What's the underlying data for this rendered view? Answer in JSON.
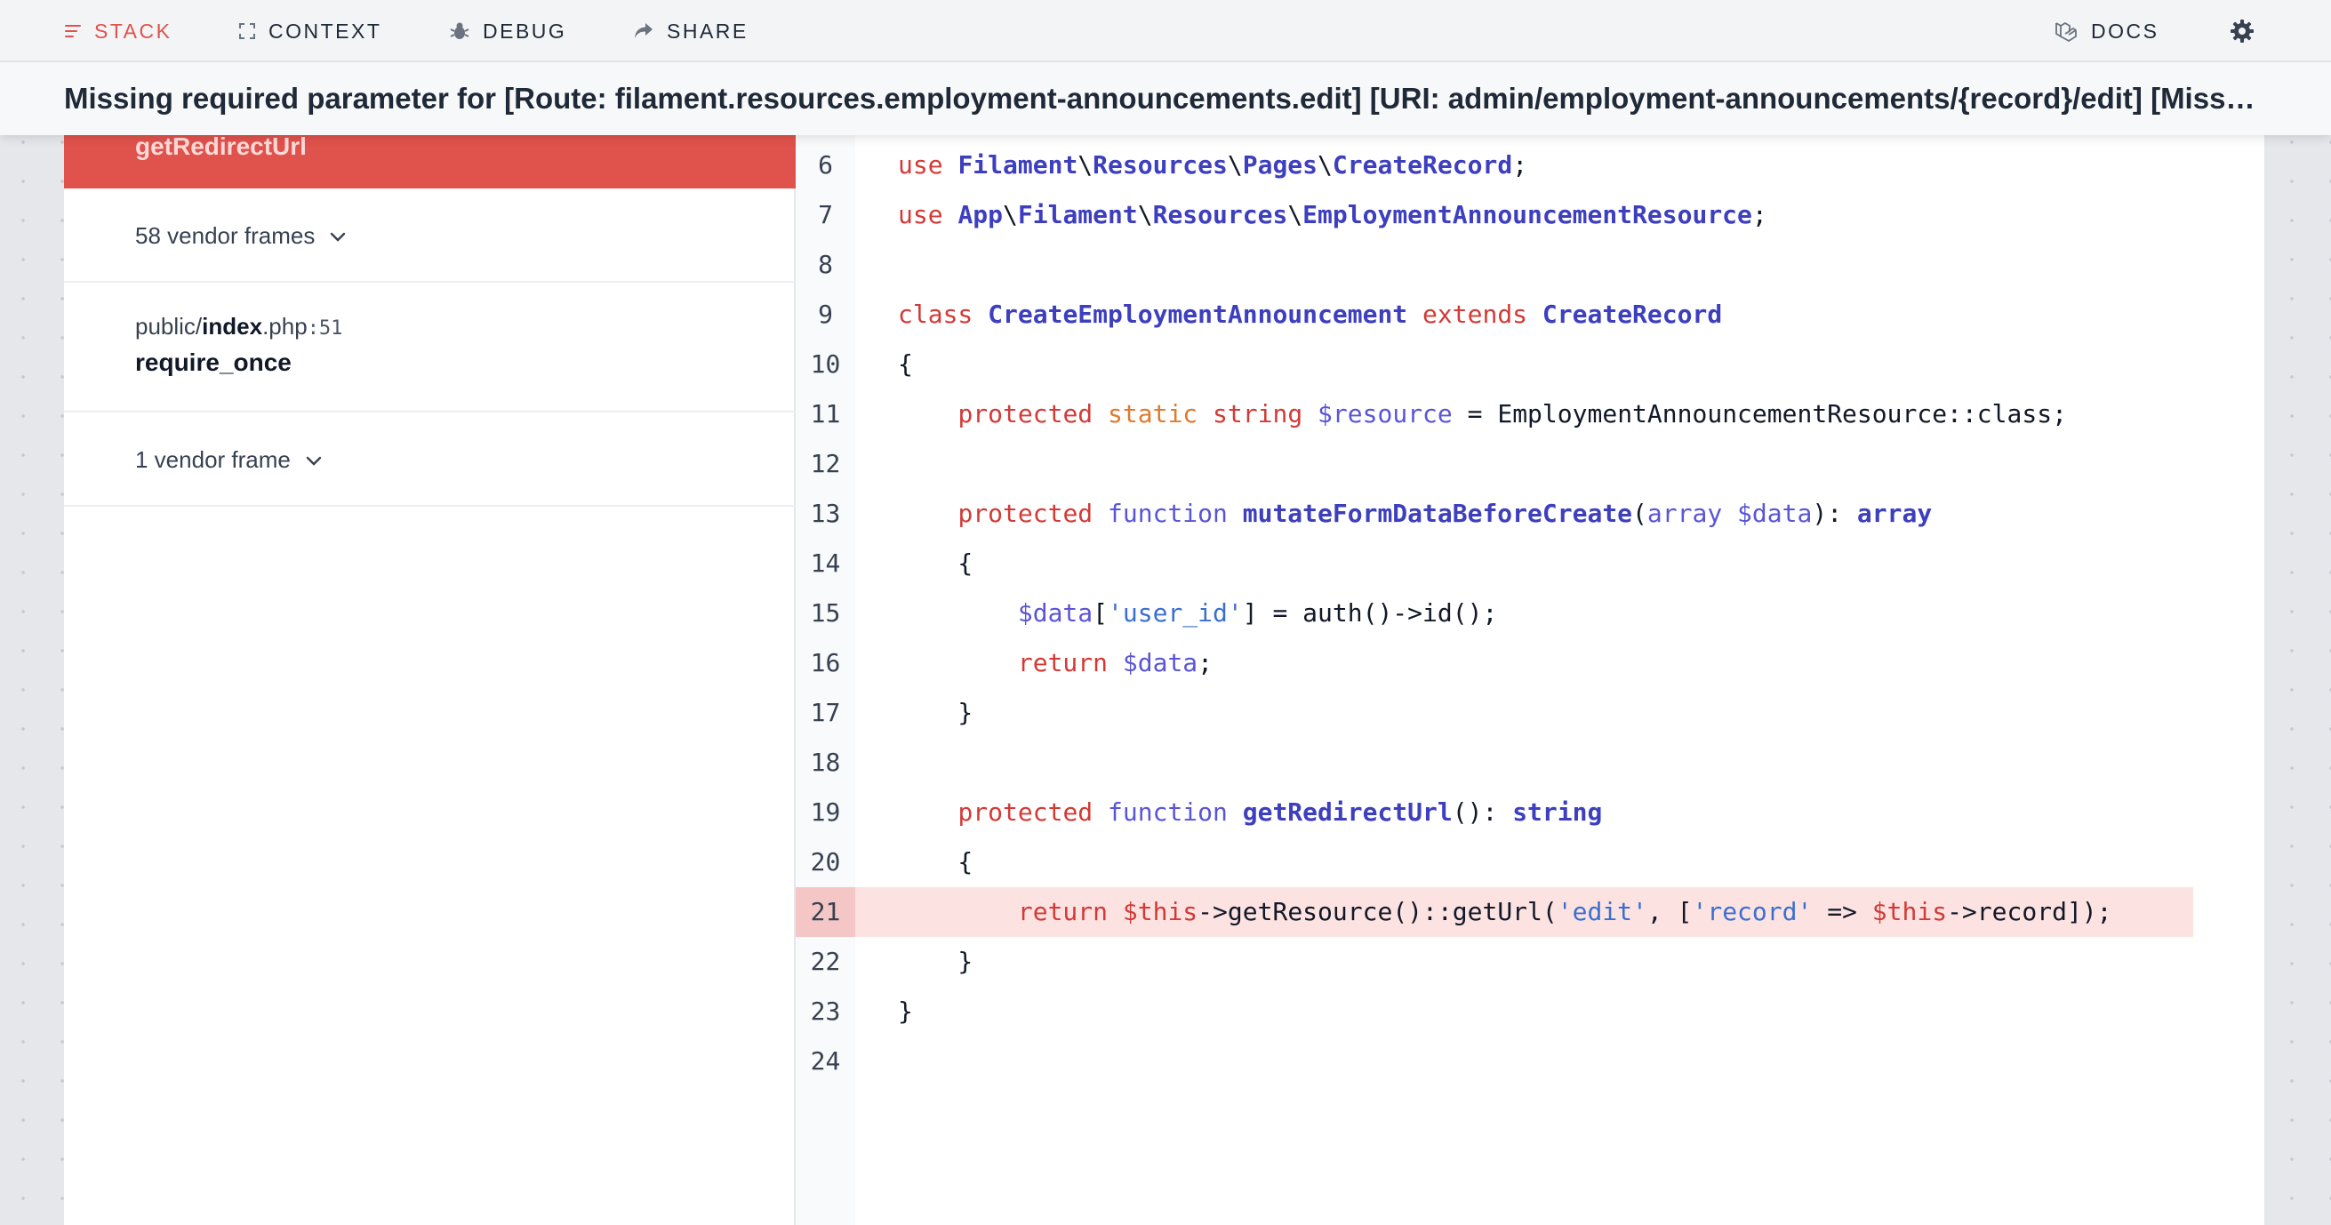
{
  "nav": {
    "stack": "STACK",
    "context": "CONTEXT",
    "debug": "DEBUG",
    "share": "SHARE",
    "docs": "DOCS"
  },
  "error": {
    "message": "Missing required parameter for [Route: filament.resources.employment-announcements.edit] [URI: admin/employment-announcements/{record}/edit] [Missing parameter: record]."
  },
  "stack": {
    "active_frame": "getRedirectUrl",
    "vendor_frames_1": "58 vendor frames",
    "app_frame": {
      "dir": "public/",
      "file": "index",
      "ext": ".php",
      "line": ":51",
      "function": "require_once"
    },
    "vendor_frames_2": "1 vendor frame"
  },
  "code": {
    "highlighted_line": 21,
    "lines": [
      {
        "n": "6",
        "tokens": [
          [
            "k",
            "use"
          ],
          [
            "p",
            " "
          ],
          [
            "b",
            "Filament"
          ],
          [
            "p",
            "\\"
          ],
          [
            "b",
            "Resources"
          ],
          [
            "p",
            "\\"
          ],
          [
            "b",
            "Pages"
          ],
          [
            "p",
            "\\"
          ],
          [
            "b",
            "CreateRecord"
          ],
          [
            "p",
            ";"
          ]
        ]
      },
      {
        "n": "7",
        "tokens": [
          [
            "k",
            "use"
          ],
          [
            "p",
            " "
          ],
          [
            "b",
            "App"
          ],
          [
            "p",
            "\\"
          ],
          [
            "b",
            "Filament"
          ],
          [
            "p",
            "\\"
          ],
          [
            "b",
            "Resources"
          ],
          [
            "p",
            "\\"
          ],
          [
            "b",
            "EmploymentAnnouncementResource"
          ],
          [
            "p",
            ";"
          ]
        ]
      },
      {
        "n": "8",
        "tokens": []
      },
      {
        "n": "9",
        "tokens": [
          [
            "k",
            "class"
          ],
          [
            "p",
            " "
          ],
          [
            "b",
            "CreateEmploymentAnnouncement"
          ],
          [
            "p",
            " "
          ],
          [
            "k",
            "extends"
          ],
          [
            "p",
            " "
          ],
          [
            "b",
            "CreateRecord"
          ]
        ]
      },
      {
        "n": "10",
        "tokens": [
          [
            "p",
            "{"
          ]
        ]
      },
      {
        "n": "11",
        "tokens": [
          [
            "p",
            "    "
          ],
          [
            "k",
            "protected"
          ],
          [
            "p",
            " "
          ],
          [
            "o",
            "static"
          ],
          [
            "p",
            " "
          ],
          [
            "k",
            "string"
          ],
          [
            "p",
            " "
          ],
          [
            "v",
            "$resource"
          ],
          [
            "p",
            " = EmploymentAnnouncementResource::class;"
          ]
        ]
      },
      {
        "n": "12",
        "tokens": []
      },
      {
        "n": "13",
        "tokens": [
          [
            "p",
            "    "
          ],
          [
            "k",
            "protected"
          ],
          [
            "p",
            " "
          ],
          [
            "v",
            "function"
          ],
          [
            "p",
            " "
          ],
          [
            "b",
            "mutateFormDataBeforeCreate"
          ],
          [
            "p",
            "("
          ],
          [
            "v",
            "array"
          ],
          [
            "p",
            " "
          ],
          [
            "v",
            "$data"
          ],
          [
            "p",
            "): "
          ],
          [
            "b",
            "array"
          ]
        ]
      },
      {
        "n": "14",
        "tokens": [
          [
            "p",
            "    {"
          ]
        ]
      },
      {
        "n": "15",
        "tokens": [
          [
            "p",
            "        "
          ],
          [
            "v",
            "$data"
          ],
          [
            "p",
            "["
          ],
          [
            "s",
            "'user_id'"
          ],
          [
            "p",
            "] = auth()->id();"
          ]
        ]
      },
      {
        "n": "16",
        "tokens": [
          [
            "p",
            "        "
          ],
          [
            "k",
            "return"
          ],
          [
            "p",
            " "
          ],
          [
            "v",
            "$data"
          ],
          [
            "p",
            ";"
          ]
        ]
      },
      {
        "n": "17",
        "tokens": [
          [
            "p",
            "    }"
          ]
        ]
      },
      {
        "n": "18",
        "tokens": []
      },
      {
        "n": "19",
        "tokens": [
          [
            "p",
            "    "
          ],
          [
            "k",
            "protected"
          ],
          [
            "p",
            " "
          ],
          [
            "v",
            "function"
          ],
          [
            "p",
            " "
          ],
          [
            "b",
            "getRedirectUrl"
          ],
          [
            "p",
            "(): "
          ],
          [
            "b",
            "string"
          ]
        ]
      },
      {
        "n": "20",
        "tokens": [
          [
            "p",
            "    {"
          ]
        ]
      },
      {
        "n": "21",
        "tokens": [
          [
            "p",
            "        "
          ],
          [
            "k",
            "return"
          ],
          [
            "p",
            " "
          ],
          [
            "k",
            "$this"
          ],
          [
            "p",
            "->getResource()::getUrl("
          ],
          [
            "s",
            "'edit'"
          ],
          [
            "p",
            ", ["
          ],
          [
            "s",
            "'record'"
          ],
          [
            "p",
            " => "
          ],
          [
            "k",
            "$this"
          ],
          [
            "p",
            "->record]);"
          ]
        ]
      },
      {
        "n": "22",
        "tokens": [
          [
            "p",
            "    }"
          ]
        ]
      },
      {
        "n": "23",
        "tokens": [
          [
            "p",
            "}"
          ]
        ]
      },
      {
        "n": "24",
        "tokens": []
      }
    ]
  },
  "colors": {
    "accent": "#e0524c",
    "keyword": "#d33a36",
    "class_name": "#3d3fbf",
    "variable": "#5a55d6",
    "string": "#3a6fd0",
    "static": "#e07a2e",
    "highlight": "#fde2e2"
  },
  "icons": {
    "stack": "list-lines-icon",
    "context": "expand-corners-icon",
    "debug": "bug-icon",
    "share": "share-arrow-icon",
    "docs": "laravel-logo-icon",
    "settings": "gear-icon",
    "chevron": "chevron-down-icon"
  }
}
